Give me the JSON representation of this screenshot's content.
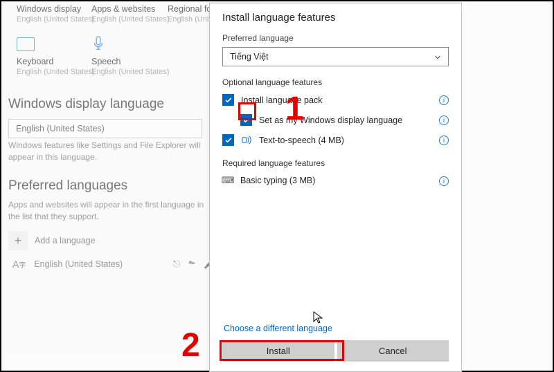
{
  "bg": {
    "tiles": {
      "winDisplay": {
        "title": "Windows display",
        "sub": "English (United States)"
      },
      "apps": {
        "title": "Apps & websites",
        "sub": "English (United States)"
      },
      "regional": {
        "title": "Regional for",
        "sub": "English (United States)"
      },
      "keyboard": {
        "title": "Keyboard",
        "sub": "English (United States)"
      },
      "speech": {
        "title": "Speech",
        "sub": "English (United States)"
      }
    },
    "sectionDisplay": "Windows display language",
    "displaySelected": "English (United States)",
    "displayHint": "Windows features like Settings and File Explorer will appear in this language.",
    "sectionPreferred": "Preferred languages",
    "preferredHint": "Apps and websites will appear in the first language in the list that they support.",
    "addLang": "Add a language",
    "langItem": "English (United States)"
  },
  "dialog": {
    "title": "Install language features",
    "preferredLabel": "Preferred language",
    "selected": "Tiếng Việt",
    "optionalLabel": "Optional language features",
    "feat1": "Install language pack",
    "feat2": "Set as my Windows display language",
    "feat3": "Text-to-speech (4 MB)",
    "requiredLabel": "Required language features",
    "feat4": "Basic typing (3 MB)",
    "link": "Choose a different language",
    "install": "Install",
    "cancel": "Cancel"
  },
  "anno": {
    "n1": "1",
    "n2": "2"
  }
}
